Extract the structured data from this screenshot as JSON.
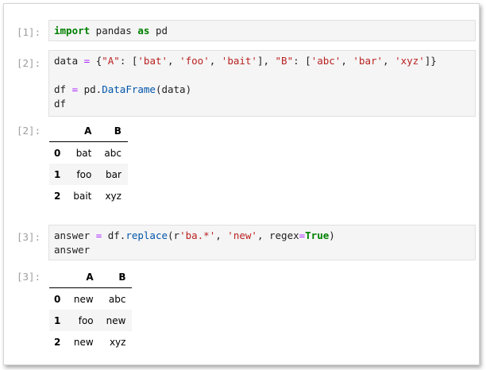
{
  "cells": [
    {
      "in_prompt": "[1]:"
    },
    {
      "in_prompt": "[2]:",
      "out_prompt": "[2]:",
      "table": {
        "columns": [
          "A",
          "B"
        ],
        "rows": [
          {
            "index": "0",
            "A": "bat",
            "B": "abc"
          },
          {
            "index": "1",
            "A": "foo",
            "B": "bar"
          },
          {
            "index": "2",
            "A": "bait",
            "B": "xyz"
          }
        ]
      }
    },
    {
      "in_prompt": "[3]:",
      "out_prompt": "[3]:",
      "table": {
        "columns": [
          "A",
          "B"
        ],
        "rows": [
          {
            "index": "0",
            "A": "new",
            "B": "abc"
          },
          {
            "index": "1",
            "A": "foo",
            "B": "new"
          },
          {
            "index": "2",
            "A": "new",
            "B": "xyz"
          }
        ]
      }
    }
  ],
  "code": {
    "c1": {
      "kw_import": "import",
      "mod": " pandas ",
      "kw_as": "as",
      "alias": " pd"
    },
    "c2": {
      "l1_a": "data ",
      "l1_eq": "=",
      "l1_b": " {",
      "s_A": "\"A\"",
      "colon1": ": [",
      "s_bat": "'bat'",
      "comma1": ", ",
      "s_foo": "'foo'",
      "comma2": ", ",
      "s_bait": "'bait'",
      "mid": "], ",
      "s_B": "\"B\"",
      "colon2": ": [",
      "s_abc": "'abc'",
      "comma3": ", ",
      "s_bar": "'bar'",
      "comma4": ", ",
      "s_xyz": "'xyz'",
      "end1": "]}",
      "l3_a": "df ",
      "l3_eq": "=",
      "l3_b": " pd.",
      "l3_fn": "DataFrame",
      "l3_c": "(data)",
      "l4": "df"
    },
    "c3": {
      "l1_a": "answer ",
      "l1_eq": "=",
      "l1_b": " df.",
      "l1_fn": "replace",
      "l1_c": "(r",
      "s_pat": "'ba.*'",
      "comma1": ", ",
      "s_new": "'new'",
      "comma2": ", regex",
      "eq2": "=",
      "kw_true": "True",
      "end": ")",
      "l2": "answer"
    }
  }
}
